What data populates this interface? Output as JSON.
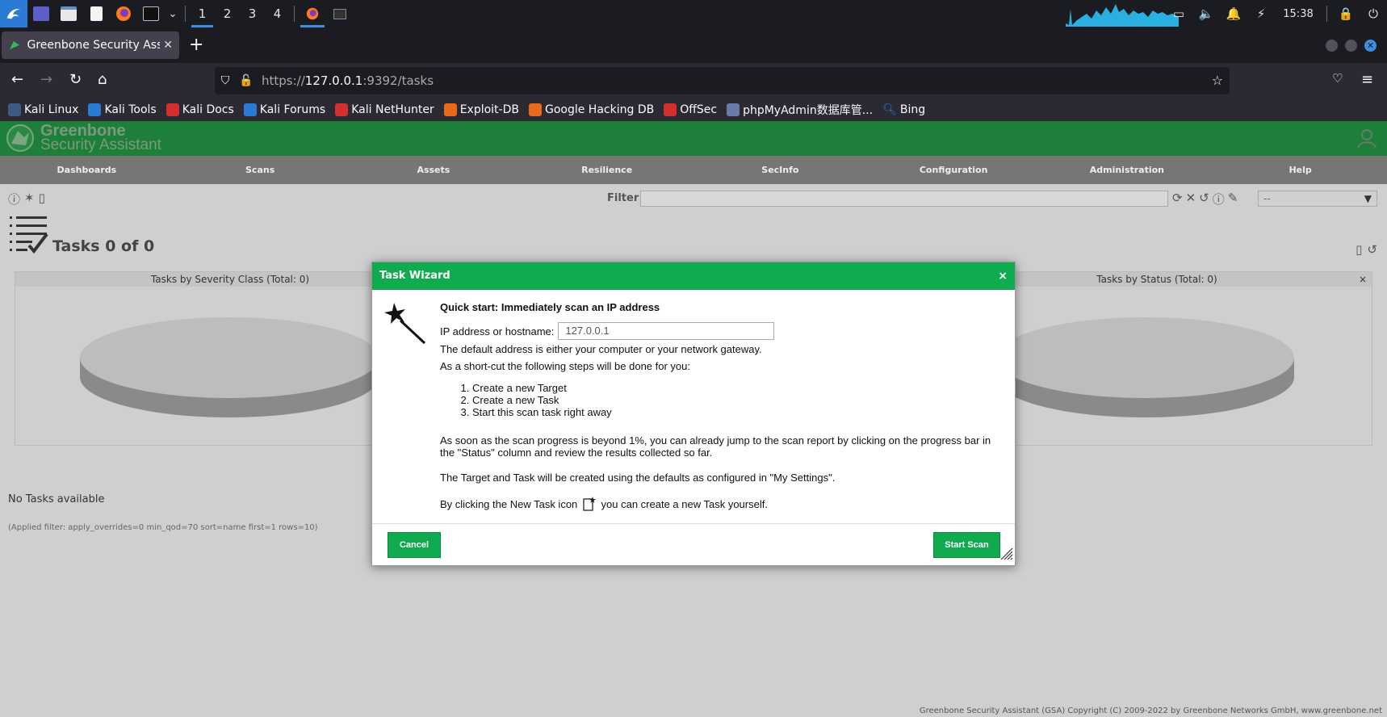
{
  "os_panel": {
    "workspaces": [
      "1",
      "2",
      "3",
      "4"
    ],
    "clock": "15:38"
  },
  "browser": {
    "tab_title": "Greenbone Security Assist",
    "url_prefix": "https://",
    "url_host": "127.0.0.1",
    "url_rest": ":9392/tasks",
    "bookmarks": [
      {
        "label": "Kali Linux",
        "color": "#3d5a80"
      },
      {
        "label": "Kali Tools",
        "color": "#2a7bd5"
      },
      {
        "label": "Kali Docs",
        "color": "#d32f2f"
      },
      {
        "label": "Kali Forums",
        "color": "#2a7bd5"
      },
      {
        "label": "Kali NetHunter",
        "color": "#d32f2f"
      },
      {
        "label": "Exploit-DB",
        "color": "#e86a1a"
      },
      {
        "label": "Google Hacking DB",
        "color": "#e86a1a"
      },
      {
        "label": "OffSec",
        "color": "#d32f2f"
      },
      {
        "label": "phpMyAdmin数据库管...",
        "color": "#6c7aa8"
      },
      {
        "label": "Bing",
        "color": "#2a7bd5"
      }
    ]
  },
  "gsa": {
    "logo_line1": "Greenbone",
    "logo_line2": "Security Assistant",
    "menu": [
      "Dashboards",
      "Scans",
      "Assets",
      "Resilience",
      "SecInfo",
      "Configuration",
      "Administration",
      "Help"
    ],
    "filter_label": "Filter",
    "filter_value": "",
    "filter_select": "--",
    "page_title": "Tasks 0 of 0",
    "chart_left_title": "Tasks by Severity Class (Total: 0)",
    "chart_right_title": "Tasks by Status (Total: 0)",
    "chart_close": "×",
    "no_tasks": "No Tasks available",
    "applied_filter": "(Applied filter: apply_overrides=0 min_qod=70 sort=name first=1 rows=10)",
    "copyright": "Greenbone Security Assistant (GSA) Copyright (C) 2009-2022 by Greenbone Networks GmbH, www.greenbone.net"
  },
  "wizard": {
    "title": "Task Wizard",
    "close": "×",
    "quick_start": "Quick start: Immediately scan an IP address",
    "ip_label": "IP address or hostname:",
    "ip_value": "127.0.0.1",
    "default_text": "The default address is either your computer or your network gateway.",
    "shortcut_text": "As a short-cut the following steps will be done for you:",
    "steps": [
      "Create a new Target",
      "Create a new Task",
      "Start this scan task right away"
    ],
    "progress_text": "As soon as the scan progress is beyond 1%, you can already jump to the scan report by clicking on the progress bar in the \"Status\" column and review the results collected so far.",
    "defaults_text": "The Target and Task will be created using the defaults as configured in \"My Settings\".",
    "newtask_pre": "By clicking the New Task icon",
    "newtask_post": "you can create a new Task yourself.",
    "cancel_label": "Cancel",
    "start_label": "Start Scan"
  }
}
